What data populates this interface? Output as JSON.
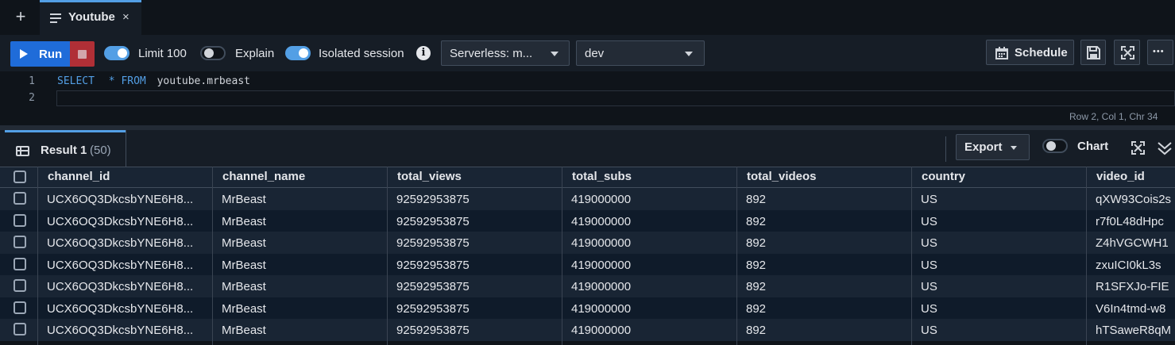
{
  "tabs": [
    {
      "label": "Youtube",
      "close": "×"
    }
  ],
  "toolbar": {
    "run_label": "Run",
    "limit_label": "Limit 100",
    "limit_on": true,
    "explain_label": "Explain",
    "explain_on": false,
    "isolated_label": "Isolated session",
    "isolated_on": true,
    "info_glyph": "i",
    "workgroup_value": "Serverless: m...",
    "database_value": "dev",
    "schedule_label": "Schedule",
    "more_label": "•••"
  },
  "editor": {
    "lines": [
      {
        "num": "1",
        "kw1": "SELECT",
        "star": "*",
        "kw2": "FROM",
        "rest": "youtube.mrbeast"
      },
      {
        "num": "2"
      }
    ],
    "status": "Row 2,  Col 1,  Chr 34"
  },
  "results": {
    "tab_label": "Result 1",
    "tab_count": "(50)",
    "export_label": "Export",
    "chart_label": "Chart",
    "chart_on": false,
    "columns": [
      "channel_id",
      "channel_name",
      "total_views",
      "total_subs",
      "total_videos",
      "country",
      "video_id"
    ],
    "rows": [
      [
        "UCX6OQ3DkcsbYNE6H8...",
        "MrBeast",
        "92592953875",
        "419000000",
        "892",
        "US",
        "qXW93Cois2s"
      ],
      [
        "UCX6OQ3DkcsbYNE6H8...",
        "MrBeast",
        "92592953875",
        "419000000",
        "892",
        "US",
        "r7f0L48dHpc"
      ],
      [
        "UCX6OQ3DkcsbYNE6H8...",
        "MrBeast",
        "92592953875",
        "419000000",
        "892",
        "US",
        "Z4hVGCWH1"
      ],
      [
        "UCX6OQ3DkcsbYNE6H8...",
        "MrBeast",
        "92592953875",
        "419000000",
        "892",
        "US",
        "zxuICI0kL3s"
      ],
      [
        "UCX6OQ3DkcsbYNE6H8...",
        "MrBeast",
        "92592953875",
        "419000000",
        "892",
        "US",
        "R1SFXJo-FIE"
      ],
      [
        "UCX6OQ3DkcsbYNE6H8...",
        "MrBeast",
        "92592953875",
        "419000000",
        "892",
        "US",
        "V6In4tmd-w8"
      ],
      [
        "UCX6OQ3DkcsbYNE6H8...",
        "MrBeast",
        "92592953875",
        "419000000",
        "892",
        "US",
        "hTSaweR8qM"
      ]
    ]
  },
  "colors": {
    "accent": "#539fe5",
    "run": "#1f6cd9",
    "stop": "#b02f36",
    "bg": "#0f141a"
  }
}
